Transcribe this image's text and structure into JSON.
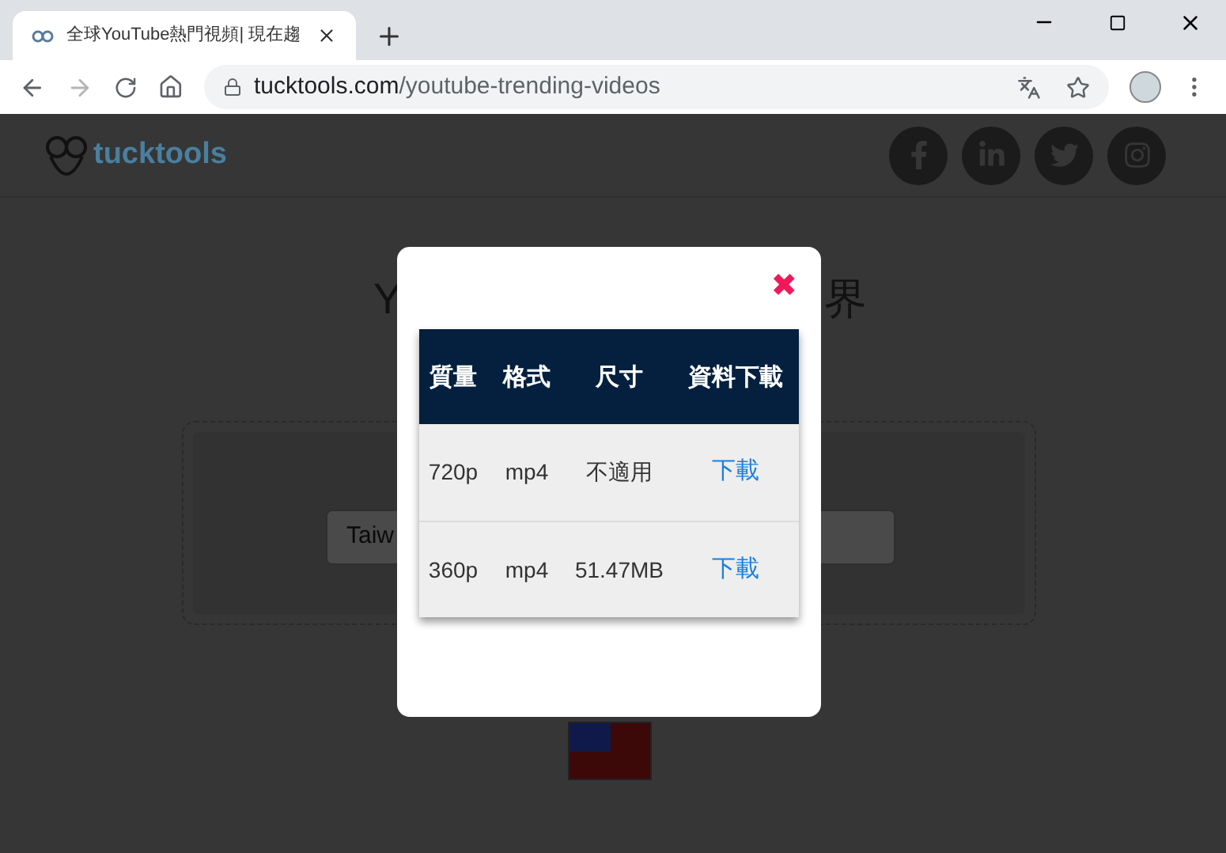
{
  "browser": {
    "tab": {
      "title": "全球YouTube熱門視頻| 現在趨",
      "selected": true
    },
    "address": {
      "domain": "tucktools.com",
      "path": "/youtube-trending-videos"
    }
  },
  "site": {
    "logo": "tucktools"
  },
  "page": {
    "heading_start": "Y",
    "heading_end": "界",
    "country_field_value": "Taiw"
  },
  "modal": {
    "close": "✖",
    "table": {
      "columns": [
        "質量",
        "格式",
        "尺寸",
        "資料下載"
      ],
      "rows": [
        {
          "cells": [
            "720p",
            "mp4",
            "不適用"
          ],
          "link": "下載"
        },
        {
          "cells": [
            "360p",
            "mp4",
            "51.47MB"
          ],
          "link": "下載"
        }
      ]
    }
  }
}
